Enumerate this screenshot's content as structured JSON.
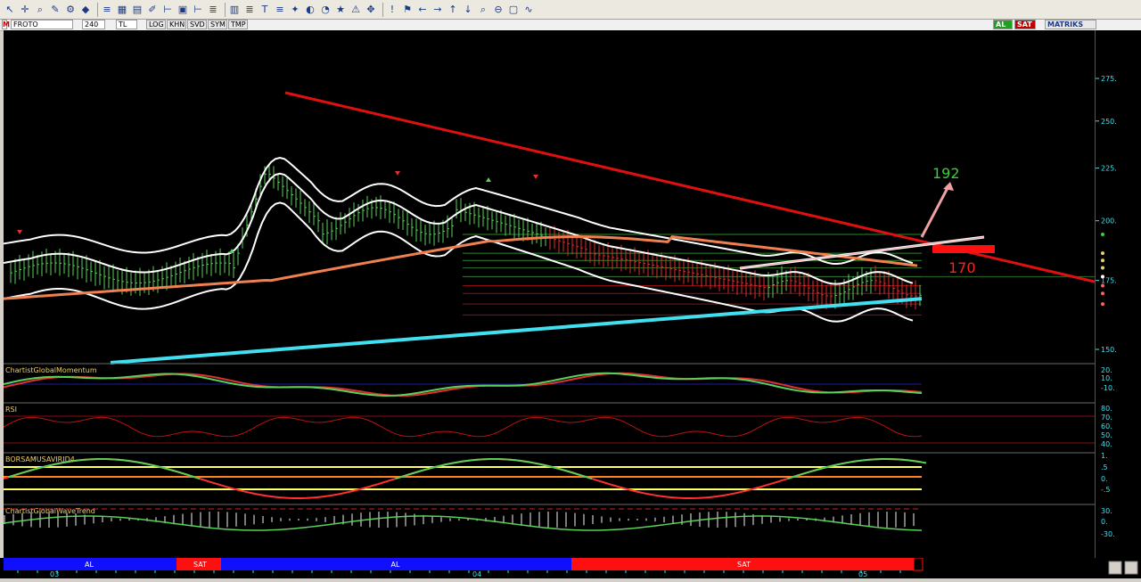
{
  "toolbar": {
    "icons": [
      "pointer-icon",
      "crosshair-icon",
      "zoom-icon",
      "draw-icon",
      "settings-icon",
      "fill-icon",
      "list-icon",
      "grid-icon",
      "table-icon",
      "pen-icon",
      "ruler-icon",
      "calendar-icon",
      "ruler2-icon",
      "stack-icon",
      "layout-icon",
      "stack2-icon",
      "text-icon",
      "list2-icon",
      "marker-icon",
      "palette-icon",
      "gauge-icon",
      "star-icon",
      "warning-icon",
      "move-icon",
      "alert-icon",
      "flag-icon",
      "arrow-left-icon",
      "arrow-right-icon",
      "arrow-up-icon",
      "arrow-down-icon",
      "search-icon",
      "zoom-out-icon",
      "frame-icon",
      "graph-icon"
    ]
  },
  "symbol_bar": {
    "symbol": "FROTO",
    "period": "240",
    "currency": "TL",
    "scale": "LOG",
    "k1": "KHN",
    "k2": "SVD",
    "k3": "SYM",
    "k4": "TMP",
    "tag_al": "AL",
    "tag_sat": "SAT",
    "brand": "MATRIKS"
  },
  "price_axis": {
    "ticks": [
      "275.",
      "250.",
      "225.",
      "200.",
      "175.",
      "150."
    ],
    "current_price": "176.5"
  },
  "annotations": {
    "target_up": "192",
    "target_down": "170"
  },
  "indicators": {
    "momentum": {
      "name": "ChartistGlobalMomentum",
      "ticks": [
        "20.",
        "10.",
        "-10."
      ]
    },
    "rsi": {
      "name": "RSI",
      "ticks": [
        "80.",
        "70.",
        "60.",
        "50.",
        "40."
      ]
    },
    "borsa": {
      "name": "BORSAMUSAVIRID4",
      "ticks": [
        "1.",
        ".5",
        "0.",
        "-.5"
      ]
    },
    "wave": {
      "name": "ChartistGlobalWaveTrend",
      "ticks": [
        "30.",
        "0.",
        "-30."
      ]
    }
  },
  "signal_bar": [
    {
      "label": "AL",
      "color": "#1010ff"
    },
    {
      "label": "SAT",
      "color": "#ff1010"
    },
    {
      "label": "AL",
      "color": "#1010ff"
    },
    {
      "label": "SAT",
      "color": "#ff1010"
    }
  ],
  "time_axis": [
    "03",
    "04",
    "05"
  ],
  "colors": {
    "background": "#000000",
    "bollinger": "#ffffff",
    "ma_orange": "#f08050",
    "trend_cyan": "#40e0f0",
    "trend_red": "#e01010",
    "grid_green": "#2a6e2a",
    "bull": "#5ad05a",
    "bear": "#e03030"
  }
}
